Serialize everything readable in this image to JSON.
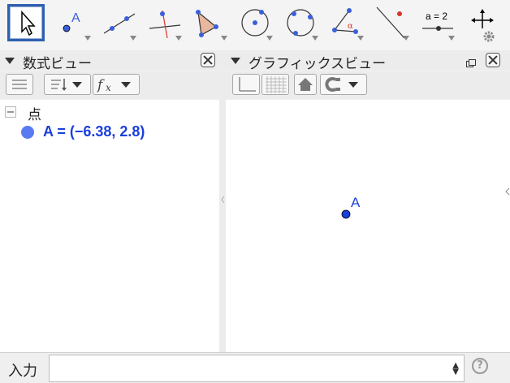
{
  "toolbar": {
    "tools": [
      {
        "name": "move-tool",
        "icon": "arrow-pointer-icon",
        "selected": true
      },
      {
        "name": "point-tool",
        "icon": "point-icon",
        "label": "A"
      },
      {
        "name": "line-tool",
        "icon": "line-through-two-points-icon"
      },
      {
        "name": "perpendicular-line-tool",
        "icon": "perpendicular-line-icon"
      },
      {
        "name": "polygon-tool",
        "icon": "polygon-icon"
      },
      {
        "name": "circle-tool",
        "icon": "circle-center-point-icon"
      },
      {
        "name": "circle-three-points-tool",
        "icon": "circle-three-points-icon"
      },
      {
        "name": "angle-tool",
        "icon": "angle-icon",
        "label": "α"
      },
      {
        "name": "reflect-tool",
        "icon": "reflect-about-line-icon"
      },
      {
        "name": "slider-tool",
        "icon": "slider-icon",
        "label": "a = 2"
      },
      {
        "name": "move-graphics-view-tool",
        "icon": "move-graphics-view-icon"
      }
    ],
    "settings_icon": "gear-icon"
  },
  "algebra_view": {
    "title": "数式ビュー",
    "category": "点",
    "items": [
      {
        "label": "A = (−6.38, 2.8)",
        "color": "#5a7bf0"
      }
    ]
  },
  "graphics_view": {
    "title": "グラフィックスビュー",
    "point": {
      "label": "A",
      "color": "#1a3fdc"
    }
  },
  "input_bar": {
    "label": "入力",
    "value": "",
    "help": "?"
  }
}
